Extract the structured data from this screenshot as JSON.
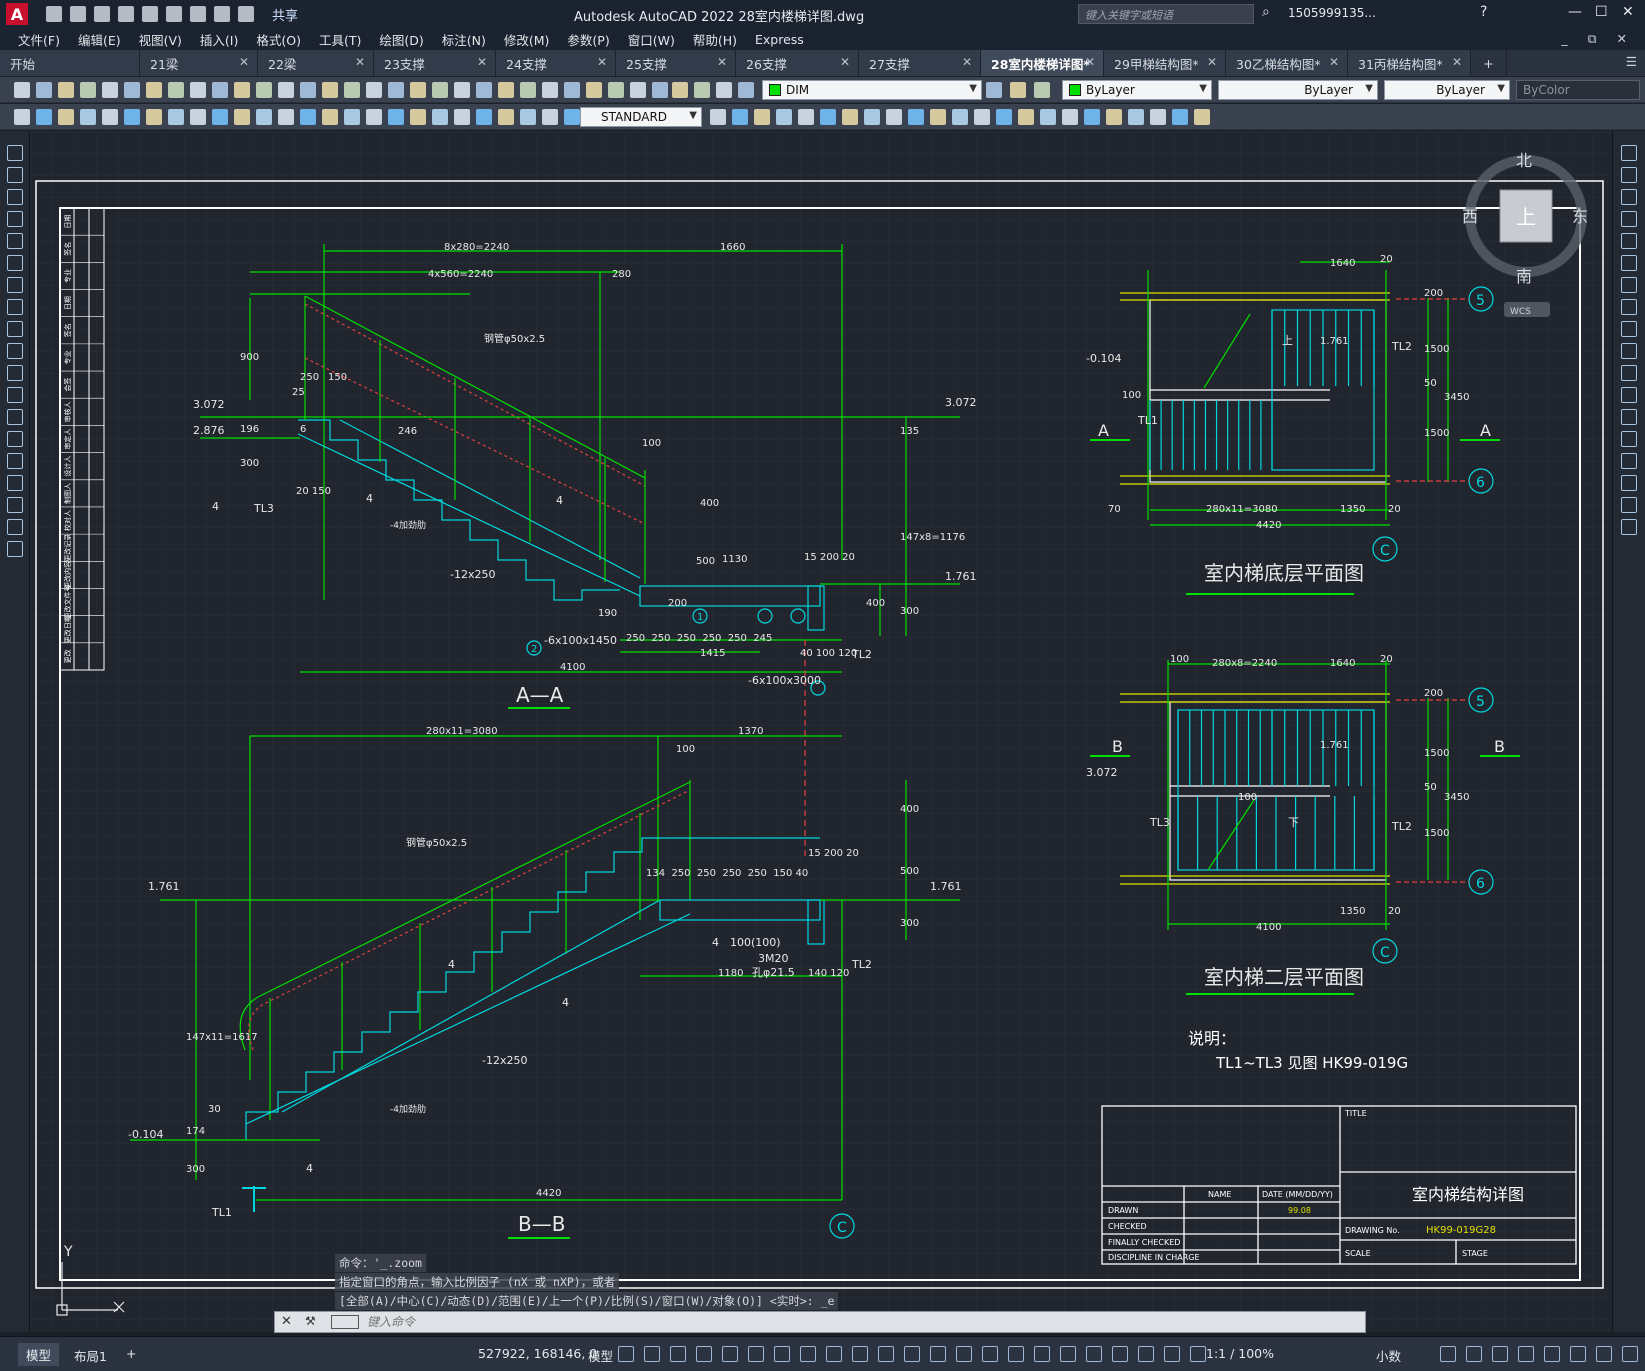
{
  "app": {
    "title": "Autodesk AutoCAD 2022    28室内楼梯详图.dwg",
    "logo": "A",
    "share": "共享",
    "search_placeholder": "键入关键字或短语",
    "user": "1505999135...",
    "window_controls": [
      "—",
      "☐",
      "✕"
    ]
  },
  "menu": [
    "文件(F)",
    "编辑(E)",
    "视图(V)",
    "插入(I)",
    "格式(O)",
    "工具(T)",
    "绘图(D)",
    "标注(N)",
    "修改(M)",
    "参数(P)",
    "窗口(W)",
    "帮助(H)",
    "Express"
  ],
  "tabs": [
    {
      "label": "开始",
      "active": false
    },
    {
      "label": "21梁",
      "active": false
    },
    {
      "label": "22梁",
      "active": false
    },
    {
      "label": "23支撑",
      "active": false
    },
    {
      "label": "24支撑",
      "active": false
    },
    {
      "label": "25支撑",
      "active": false
    },
    {
      "label": "26支撑",
      "active": false
    },
    {
      "label": "27支撑",
      "active": false
    },
    {
      "label": "28室内楼梯详图*",
      "active": true
    },
    {
      "label": "29甲梯结构图*",
      "active": false
    },
    {
      "label": "30乙梯结构图*",
      "active": false
    },
    {
      "label": "31丙梯结构图*",
      "active": false
    }
  ],
  "toolbar": {
    "layer": "DIM",
    "color": "ByLayer",
    "linetype": "ByLayer",
    "lineweight": "ByLayer",
    "plotstyle": "ByColor",
    "textstyle": "STANDARD"
  },
  "viewcube": {
    "north": "北",
    "south": "南",
    "east": "东",
    "west": "西",
    "top": "上",
    "wcs": "WCS"
  },
  "drawing": {
    "section_aa": "A—A",
    "section_bb": "B—B",
    "plan_ground": "室内梯底层平面图",
    "plan_second": "室内梯二层平面图",
    "note_title": "说明：",
    "note_text": "TL1~TL3 见图 HK99-019G",
    "title_block": {
      "title": "TITLE",
      "name": "NAME",
      "date": "DATE (MM/DD/YY)",
      "drawn": "DRAWN",
      "date_value": "99.08",
      "checked": "CHECKED",
      "finally_checked": "FINALLY CHECKED",
      "discipline": "DISCIPLINE IN CHARGE",
      "drawing_title": "室内梯结构详图",
      "drawing_no_label": "DRAWING No.",
      "drawing_no": "HK99-019G28",
      "scale": "SCALE",
      "stage": "STAGE"
    },
    "aa": {
      "dim_top1": "8x280=2240",
      "dim_top2": "1660",
      "dim_top3": "4x560=2240",
      "dim_280": "280",
      "pipe": "钢管φ50x2.5",
      "lvl_3072": "3.072",
      "lvl_2876": "2.876",
      "lvl_3072r": "3.072",
      "lvl_1761": "1.761",
      "d_900": "900",
      "d_250": "250",
      "d_150": "150",
      "d_25": "25",
      "d_196": "196",
      "d_300": "300",
      "d_6": "6",
      "d_20_150": "20 150",
      "d_4": "4",
      "tl3": "TL3",
      "d_246": "246",
      "d_100": "100",
      "d_400": "400",
      "d_135": "135",
      "d_147": "147x8=1176",
      "d_500": "500",
      "d_1130": "1130",
      "d_15_200_20": "15 200 20",
      "d_12x250": "-12x250",
      "rib": "-4加劲肋",
      "d_190": "190",
      "d_200": "200",
      "d_row": "250  250  250  250  250  245",
      "d_1415": "1415",
      "d_40_100_120": "40 100 120",
      "plate1": "-6x100x1450",
      "plate2": "-6x100x3000",
      "d_4100": "4100",
      "tl2": "TL2",
      "d_400r": "400",
      "d_300r": "300",
      "c1": "1",
      "c2": "2"
    },
    "bb": {
      "dim_top1": "280x11=3080",
      "dim_top2": "1370",
      "d_100": "100",
      "pipe": "钢管φ50x2.5",
      "lvl_1761": "1.761",
      "lvl_1761r": "1.761",
      "lvl_m0104": "-0.104",
      "d_400": "400",
      "d_500": "500",
      "d_row": "134  250  250  250  250  150 40",
      "d_15_200_20": "15 200 20",
      "d_147": "147x11=1617",
      "d_4": "4",
      "d_100b": "100(100)",
      "bolt": "3M20",
      "hole": "孔φ21.5",
      "d_1180": "1180",
      "d_140_120": "140 120",
      "tl2": "TL2",
      "d_12x250": "-12x250",
      "rib": "-4加劲肋",
      "d_30": "30",
      "d_174": "174",
      "d_300": "300",
      "d_4420": "4420",
      "tl1": "TL1",
      "d_300r": "300"
    },
    "plan1": {
      "d_1640": "1640",
      "d_20": "20",
      "d_200": "200",
      "d_1500a": "1500",
      "d_50": "50",
      "d_1500b": "1500",
      "d_3450": "3450",
      "d_1761": "1.761",
      "up": "上",
      "tl2": "TL2",
      "tl1": "TL1",
      "lvl": "-0.104",
      "d_100": "100",
      "dim_steps": "280x11=3080",
      "d_1350": "1350",
      "d_70": "70",
      "d_20b": "20",
      "d_4420": "4420",
      "sec": "A",
      "axis5": "5",
      "axis6": "6",
      "axisC": "C"
    },
    "plan2": {
      "d_100": "100",
      "dim_steps": "280x8=2240",
      "d_1640": "1640",
      "d_20": "20",
      "d_200": "200",
      "d_1500a": "1500",
      "d_50": "50",
      "d_1500b": "1500",
      "d_3450": "3450",
      "d_1761": "1.761",
      "lvl": "3.072",
      "down": "下",
      "tl2": "TL2",
      "tl3": "TL3",
      "d_100b": "100",
      "d_1350": "1350",
      "d_20b": "20",
      "d_4100": "4100",
      "sec": "B",
      "axis5": "5",
      "axis6": "6",
      "axisC": "C"
    },
    "left_table": [
      "日期",
      "签名",
      "专业",
      "日期",
      "签名",
      "专业",
      "会签",
      "审核人",
      "审定人",
      "设计人",
      "制图人",
      "校对人",
      "更改记录",
      "更改内容",
      "更改文件号",
      "更改日期",
      "更改"
    ],
    "axis_c": "C",
    "ucs_y": "Y"
  },
  "command": {
    "history1": "命令：'_.zoom",
    "history2": "指定窗口的角点，输入比例因子 (nX 或 nXP)，或者",
    "history3": "[全部(A)/中心(C)/动态(D)/范围(E)/上一个(P)/比例(S)/窗口(W)/对象(O)] <实时>: _e",
    "placeholder": "键入命令"
  },
  "statusbar": {
    "tab_model": "模型",
    "tab_layout": "布局1",
    "coords": "527922, 168146, 0",
    "mode": "模型",
    "scale": "1:1 / 100%",
    "units": "小数"
  }
}
